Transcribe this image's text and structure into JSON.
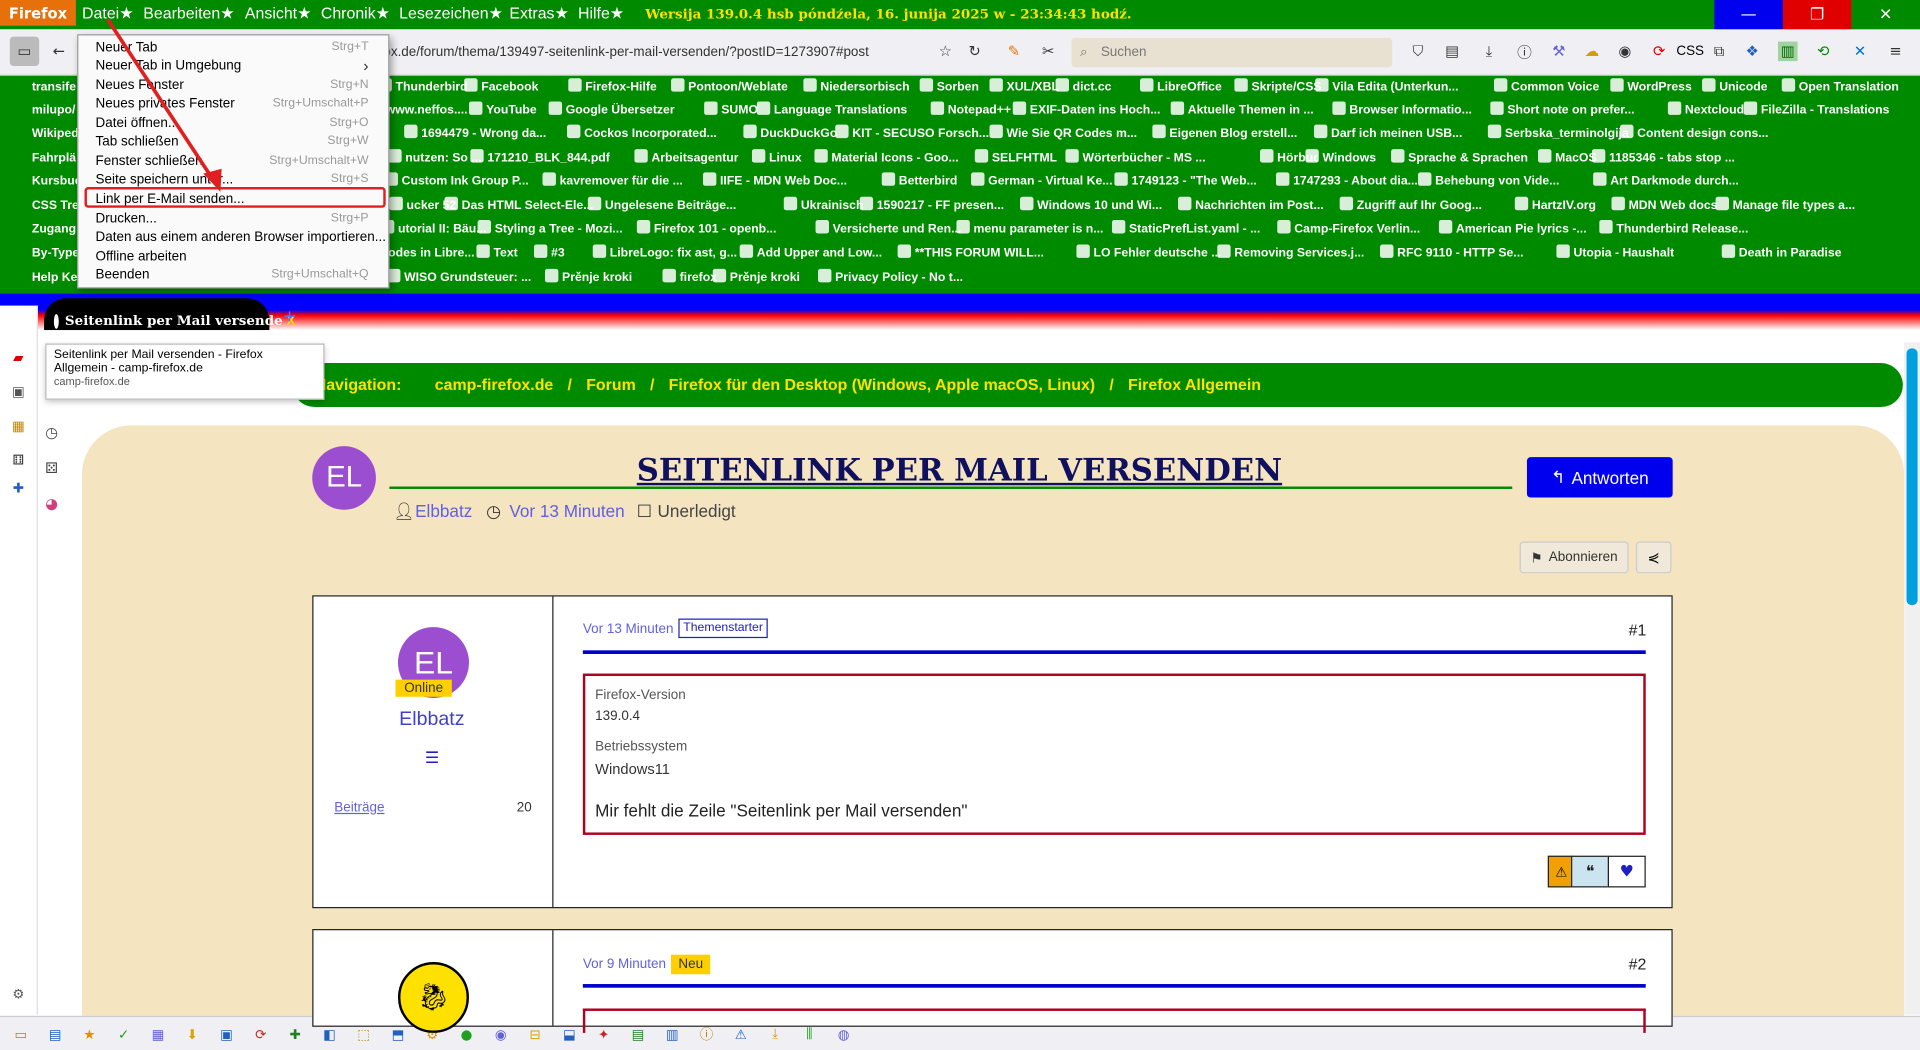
{
  "app": {
    "name": "Firefox",
    "version_line": "Wersija 139.0.4 hsb    póndźela, 16. junija 2025 w - 23:34:43 hodź."
  },
  "menubar": [
    "Datei★",
    "Bearbeiten★",
    "Ansicht★",
    "Chronik★",
    "Lesezeichen★",
    "Extras★",
    "Hilfe★"
  ],
  "toolbar": {
    "url": "fox.de/forum/thema/139497-seitenlink-per-mail-versenden/?postID=1273907#post",
    "search_placeholder": "Suchen",
    "css_label": "CSS"
  },
  "bookmarks": [
    [
      "transife",
      "Thunderbird",
      "Facebook",
      "Firefox-Hilfe",
      "Pontoon/Weblate",
      "Niedersorbisch",
      "Sorben",
      "XUL/XBL",
      "dict.cc",
      "LibreOffice",
      "Skripte/CSS",
      "Vila Edita (Unterkun...",
      "Common Voice",
      "WordPress",
      "Unicode",
      "Open Translation"
    ],
    [
      "milupo/",
      "www.neffos....",
      "YouTube",
      "Google Übersetzer",
      "SUMO",
      "Language Translations",
      "Notepad++",
      "EXIF-Daten ins Hoch...",
      "Aktuelle Themen in ...",
      "Browser Informatio...",
      "Short note on prefer...",
      "Nextcloud",
      "FileZilla - Translations"
    ],
    [
      "Wikiped",
      "1694479 - Wrong da...",
      "Cockos Incorporated...",
      "DuckDuckGo",
      "KIT - SECUSO Forsch...",
      "Wie Sie QR Codes m...",
      "Eigenen Blog erstell...",
      "Darf ich meinen USB...",
      "Serbska_terminolgija",
      "Content design cons..."
    ],
    [
      "Fahrplä",
      "nutzen: So ...",
      "171210_BLK_844.pdf",
      "Arbeitsagentur",
      "Linux",
      "Material Icons - Goo...",
      "SELFHTML",
      "Wörterbücher - MS ...",
      "Hörbuch",
      "Windows",
      "Sprache & Sprachen",
      "MacOS",
      "1185346 - tabs stop ..."
    ],
    [
      "Kursbuc",
      "Custom Ink Group P...",
      "kavremover für die ...",
      "IIFE - MDN Web Doc...",
      "Betterbird",
      "German - Virtual Ke...",
      "1749123 - \"The Web...",
      "1747293 - About dia...",
      "Behebung von Vide...",
      "Art Darkmode durch..."
    ],
    [
      "CSS Tre",
      "ucker 5200",
      "Das HTML Select-Ele...",
      "Ungelesene Beiträge...",
      "Ukrainisch",
      "1590217 - FF presen...",
      "Windows 10 und Wi...",
      "Nachrichten im Post...",
      "Zugriff auf Ihr Goog...",
      "HartzIV.org",
      "MDN Web docs",
      "Manage file types a..."
    ],
    [
      "Zugang",
      "utorial II: Bäu...",
      "Styling a Tree - Mozi...",
      "Firefox 101 - openb...",
      "Versicherte und Ren...",
      "menu parameter is n...",
      "StaticPrefList.yaml - ...",
      "Camp-Firefox Verlin...",
      "American Pie lyrics -...",
      "Thunderbird Release..."
    ],
    [
      "By-Type",
      "odes in Libre...",
      "Text",
      "#3",
      "LibreLogo: fix ast, g...",
      "Add Upper and Low...",
      "**THIS FORUM WILL...",
      "LO Fehler deutsche ...",
      "Removing Services.j...",
      "RFC 9110 - HTTP Se...",
      "Utopia - Haushalt",
      "Death in Paradise"
    ],
    [
      "Help Ke",
      "WISO Grundsteuer: ...",
      "Prěnje kroki",
      "firefox",
      "Prěnje kroki",
      "Privacy Policy - No t..."
    ]
  ],
  "file_menu": [
    {
      "label": "Neuer Tab",
      "shortcut": "Strg+T"
    },
    {
      "label": "Neuer Tab in Umgebung",
      "shortcut": "›"
    },
    {
      "label": "Neues Fenster",
      "shortcut": "Strg+N"
    },
    {
      "label": "Neues privates Fenster",
      "shortcut": "Strg+Umschalt+P"
    },
    {
      "label": "Datei öffnen...",
      "shortcut": "Strg+O"
    },
    {
      "label": "Tab schließen",
      "shortcut": "Strg+W"
    },
    {
      "label": "Fenster schließen",
      "shortcut": "Strg+Umschalt+W"
    },
    {
      "label": "Seite speichern unter...",
      "shortcut": "Strg+S"
    },
    {
      "label": "Link per E-Mail senden...",
      "shortcut": ""
    },
    {
      "label": "Drucken...",
      "shortcut": "Strg+P"
    },
    {
      "label": "Daten aus einem anderen Browser importieren...",
      "shortcut": ""
    },
    {
      "label": "Offline arbeiten",
      "shortcut": ""
    },
    {
      "label": "Beenden",
      "shortcut": "Strg+Umschalt+Q"
    }
  ],
  "tab": {
    "title": "Seitenlink per Mail versende",
    "close": "X",
    "new_tab": "+"
  },
  "tooltip": {
    "line1": "Seitenlink per Mail versenden - Firefox",
    "line2": "Allgemein - camp-firefox.de",
    "line3": "camp-firefox.de"
  },
  "breadcrumb": {
    "label": "Navigation:",
    "items": [
      "camp-firefox.de",
      "Forum",
      "Firefox für den Desktop (Windows, Apple macOS, Linux)",
      "Firefox Allgemein"
    ],
    "sep": "/"
  },
  "thread": {
    "title": "SEITENLINK PER MAIL VERSENDEN",
    "avatar": "EL",
    "author": "Elbbatz",
    "time": "Vor 13 Minuten",
    "status": "Unerledigt",
    "reply": "Antworten",
    "subscribe": "Abonnieren"
  },
  "post1": {
    "avatar": "EL",
    "online": "Online",
    "author": "Elbbatz",
    "posts_label": "Beiträge",
    "posts_count": "20",
    "time": "Vor 13 Minuten",
    "badge": "Themenstarter",
    "number": "#1",
    "ff_label": "Firefox-Version",
    "ff_value": "139.0.4",
    "os_label": "Betriebssystem",
    "os_value": "Windows11",
    "text": "Mir fehlt die Zeile \"Seitenlink per Mail versenden\""
  },
  "post2": {
    "time": "Vor 9 Minuten",
    "badge": "Neu",
    "number": "#2"
  },
  "colors": {
    "menubar": "#008a00",
    "accent": "#0000ee",
    "yellow": "#ffe100",
    "beige": "#f4e4c0",
    "avatar": "#9b4fd0",
    "highlight": "#e02020"
  }
}
